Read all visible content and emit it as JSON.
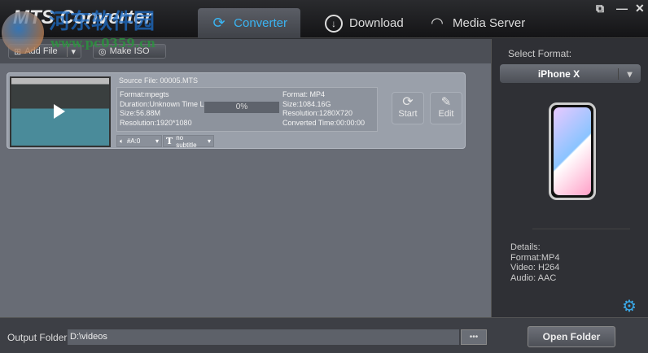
{
  "app": {
    "title": "MTS Converter",
    "watermark": "河东软件园",
    "watermark_url": "www.pc0359.cn"
  },
  "tabs": [
    {
      "label": "Converter"
    },
    {
      "label": "Download"
    },
    {
      "label": "Media Server"
    }
  ],
  "toolbar": {
    "add_file": "Add File",
    "make_iso": "Make ISO"
  },
  "file": {
    "source": "Source File: 00005.MTS",
    "in_format": "Format:mpegts",
    "in_duration": "Duration:Unknown Time Le",
    "in_size": "Size:56.88M",
    "in_resolution": "Resolution:1920*1080",
    "progress": "0%",
    "progress_value": 0,
    "out_format": "Format: MP4",
    "out_size": "Size:1084.16G",
    "out_resolution": "Resolution:1280X720",
    "out_time": "Converted Time:00:00:00",
    "audio_track": "#A:0",
    "subtitle": "no subtitle",
    "start": "Start",
    "edit": "Edit"
  },
  "right": {
    "select_label": "Select Format:",
    "format": "iPhone X",
    "details_title": "Details:",
    "details_format": "Format:MP4",
    "details_video": "Video: H264",
    "details_audio": "Audio: AAC"
  },
  "bottom": {
    "output_label": "Output Folder:",
    "output_path": "D:\\videos",
    "browse": "•••",
    "open_folder": "Open Folder"
  }
}
